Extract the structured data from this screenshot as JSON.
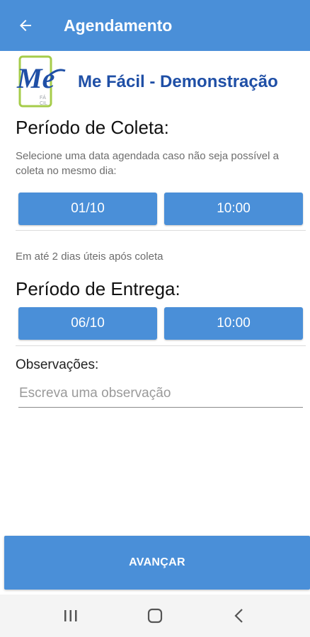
{
  "appbar": {
    "title": "Agendamento",
    "back_icon": "arrow-left-icon"
  },
  "brand": {
    "name": "Me Fácil - Demonstração",
    "logo_text": "Me",
    "logo_subtext": "FÁCIL"
  },
  "coleta": {
    "title": "Período de Coleta:",
    "hint": "Selecione uma data agendada caso não seja possível a coleta no mesmo dia:",
    "date": "01/10",
    "time": "10:00"
  },
  "entrega": {
    "hint": "Em até 2 dias úteis após coleta",
    "title": "Período de Entrega:",
    "date": "06/10",
    "time": "10:00"
  },
  "observacoes": {
    "label": "Observações:",
    "placeholder": "Escreva uma observação",
    "value": ""
  },
  "advance_label": "AVANÇAR",
  "colors": {
    "primary": "#4a8fd8",
    "brand_text": "#1f4fa6",
    "logo_green": "#a6cc4a"
  },
  "navbar": {
    "icons": [
      "recent-apps-icon",
      "home-icon",
      "back-icon"
    ]
  }
}
